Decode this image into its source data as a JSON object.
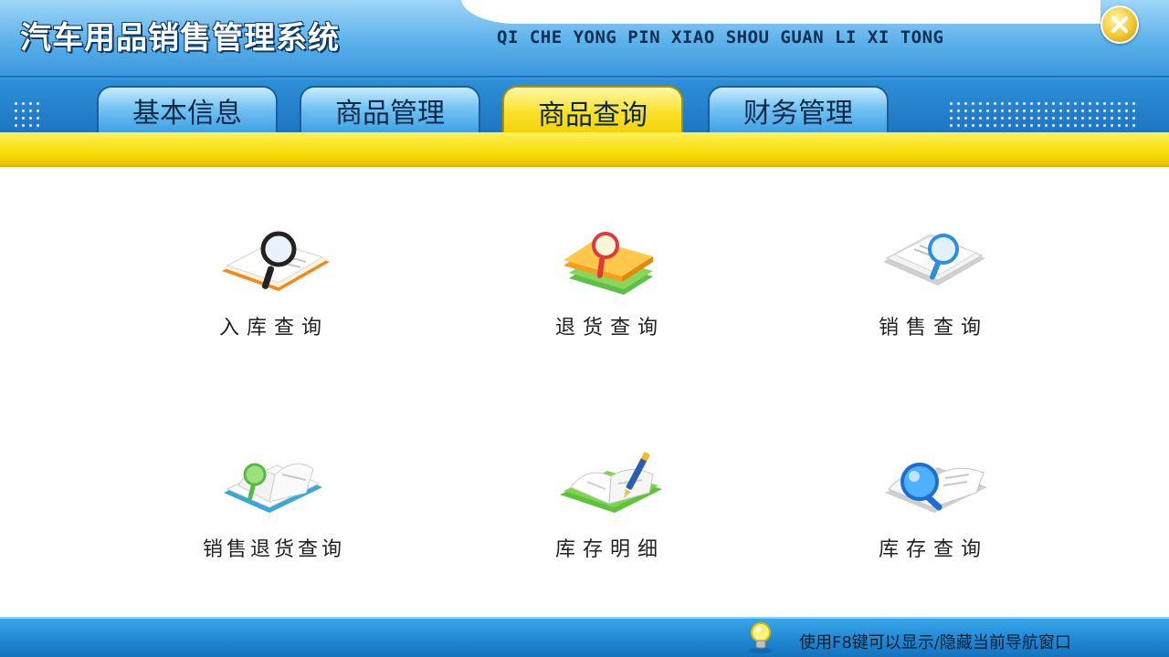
{
  "header": {
    "title": "汽车用品销售管理系统",
    "subtitle": "QI CHE YONG PIN XIAO SHOU GUAN LI XI TONG",
    "close_icon": "close-icon"
  },
  "tabs": [
    {
      "label": "基本信息",
      "active": false
    },
    {
      "label": "商品管理",
      "active": false
    },
    {
      "label": "商品查询",
      "active": true
    },
    {
      "label": "财务管理",
      "active": false
    }
  ],
  "tiles": [
    {
      "label": "入库查询",
      "icon": "stock-in-search-icon"
    },
    {
      "label": "退货查询",
      "icon": "return-search-icon"
    },
    {
      "label": "销售查询",
      "icon": "sales-search-icon"
    },
    {
      "label": "销售退货查询",
      "icon": "sales-return-search-icon"
    },
    {
      "label": "库存明细",
      "icon": "inventory-detail-icon"
    },
    {
      "label": "库存查询",
      "icon": "inventory-search-icon"
    }
  ],
  "footer": {
    "hint": "使用F8键可以显示/隐藏当前导航窗口",
    "hint_icon": "lightbulb-icon"
  },
  "colors": {
    "header_blue": "#3b9be0",
    "active_tab_yellow": "#f8dd0b",
    "footer_blue": "#1f86d2"
  }
}
